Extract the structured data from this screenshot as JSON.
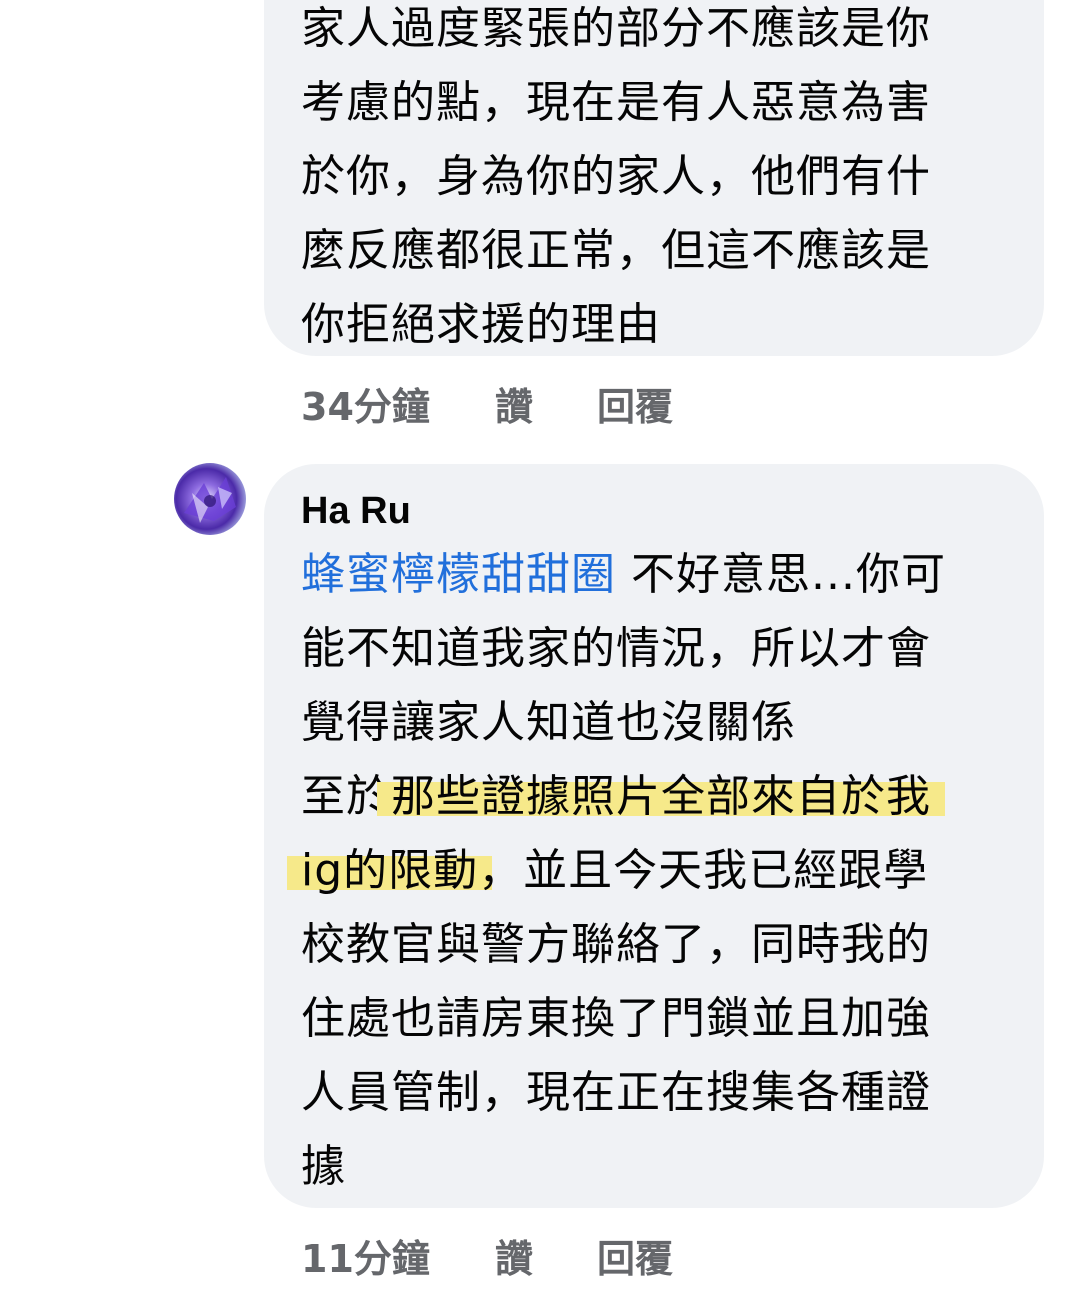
{
  "comment1": {
    "lines": [
      "家人過度緊張的部分不應該是你",
      "考慮的點，現在是有人惡意為害",
      "於你，身為你的家人，他們有什",
      "麼反應都很正常，但這不應該是",
      "你拒絕求援的理由"
    ],
    "time": "34分鐘",
    "like_label": "讚",
    "reply_label": "回覆"
  },
  "comment2": {
    "author": "Ha Ru",
    "mention": "蜂蜜檸檬甜甜圈",
    "line1_rest": " 不好意思...你可",
    "line2": "能不知道我家的情況，所以才會",
    "line3": "覺得讓家人知道也沒關係",
    "line4_a": "至於",
    "line4_highlight": "那些證據照片全部來自於我",
    "line5_highlight": "ig的限動",
    "line5_rest": "，並且今天我已經跟學",
    "line6": "校教官與警方聯絡了，同時我的",
    "line7": "住處也請房東換了門鎖並且加強",
    "line8": "人員管制，現在正在搜集各種證",
    "line9": "據",
    "time": "11分鐘",
    "like_label": "讚",
    "reply_label": "回覆"
  },
  "colors": {
    "bubble": "#f0f2f5",
    "mention": "#216fdb",
    "highlight": "#f6e98a",
    "meta": "#65676b"
  }
}
